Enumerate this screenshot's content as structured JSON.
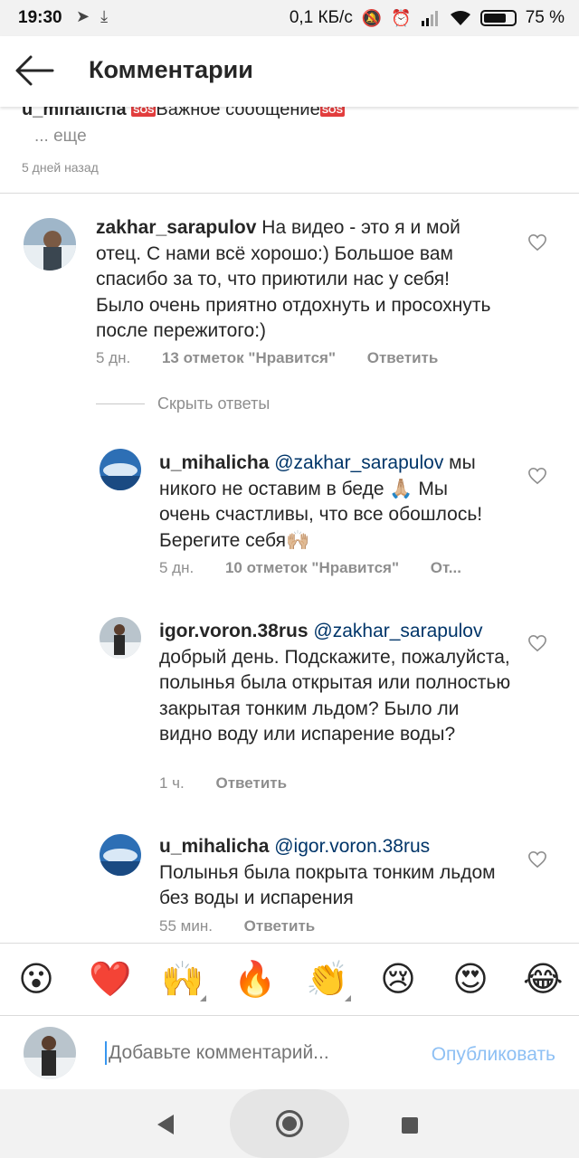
{
  "status_bar": {
    "time": "19:30",
    "network_speed": "0,1 КБ/с",
    "battery": "75 %",
    "battery_level": 0.75
  },
  "header": {
    "title": "Комментарии"
  },
  "caption": {
    "user": "u_mihalicha",
    "text": "Важное сообщение",
    "sos_label": "SOS",
    "more": "... еще",
    "time": "5 дней назад"
  },
  "comments": [
    {
      "user": "zakhar_sarapulov",
      "text": "На видео - это я и мой отец. С нами всё хорошо:) Большое вам спасибо за то, что приютили нас у себя! Было очень приятно отдохнуть и просохнуть после пережитого:)",
      "time": "5 дн.",
      "likes": "13 отметок \"Нравится\"",
      "reply": "Ответить"
    }
  ],
  "hide_replies": "Скрыть ответы",
  "replies": [
    {
      "user": "u_mihalicha",
      "mention": "@zakhar_sarapulov",
      "text": "мы никого не оставим в беде 🙏🏼 Мы очень счастливы, что все обошлось! Берегите себя🙌🏼",
      "time": "5 дн.",
      "likes": "10 отметок \"Нравится\"",
      "reply": "От..."
    },
    {
      "user": "igor.voron.38rus",
      "mention": "@zakhar_sarapulov",
      "text": "добрый день. Подскажите, пожалуйста, полынья была открытая или полностью закрытая тонким льдом? Было ли видно воду или испарение воды?",
      "time": "1 ч.",
      "reply": "Ответить"
    },
    {
      "user": "u_mihalicha",
      "mention": "@igor.voron.38rus",
      "text": "Полынья была покрыта тонким льдом без воды и испарения",
      "time": "55 мин.",
      "reply": "Ответить"
    }
  ],
  "emoji_bar": [
    "😮",
    "❤️",
    "🙌",
    "🔥",
    "👏",
    "😢",
    "😍",
    "😂"
  ],
  "composer": {
    "placeholder": "Добавьте комментарий...",
    "publish": "Опубликовать"
  },
  "colors": {
    "mention": "#003569",
    "publish_disabled": "#8ec0f4",
    "secondary_text": "#8e8e8e"
  }
}
